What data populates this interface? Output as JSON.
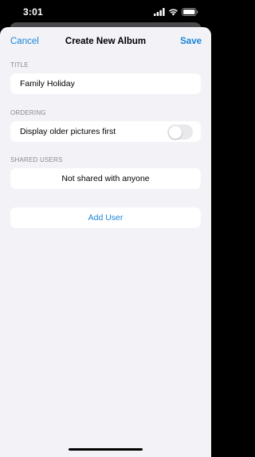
{
  "status_bar": {
    "time": "3:01",
    "icons": [
      "signal-icon",
      "wifi-icon",
      "battery-icon"
    ]
  },
  "navbar": {
    "cancel_label": "Cancel",
    "title": "Create New Album",
    "save_label": "Save"
  },
  "sections": {
    "title": {
      "header": "TITLE",
      "value": "Family Holiday"
    },
    "ordering": {
      "header": "ORDERING",
      "label": "Display older pictures first",
      "toggle_on": false
    },
    "shared_users": {
      "header": "SHARED USERS",
      "empty_text": "Not shared with anyone"
    },
    "add_user": {
      "label": "Add User"
    }
  },
  "colors": {
    "accent": "#1a84d8",
    "background": "#f2f2f7",
    "cell": "#ffffff",
    "secondary_text": "#8a8a8e",
    "toggle_off": "#e9e9eb"
  }
}
